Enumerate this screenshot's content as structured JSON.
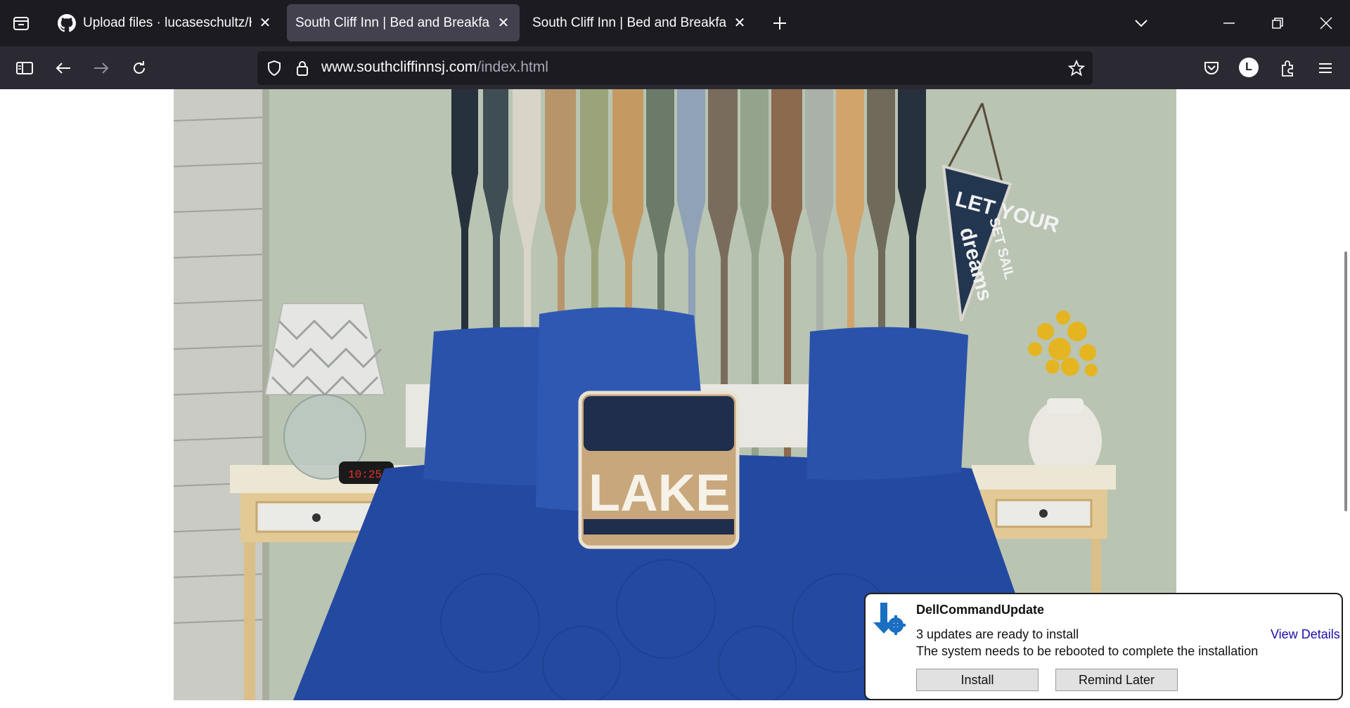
{
  "tabs": [
    {
      "title": "Upload files · lucaseschultz/HTT",
      "active": false,
      "icon": "github-icon"
    },
    {
      "title": "South Cliff Inn | Bed and Breakfast |",
      "active": true
    },
    {
      "title": "South Cliff Inn | Bed and Breakfast |",
      "active": false
    }
  ],
  "address": {
    "host": "www.southcliffinnsj.com",
    "path": "/index.html"
  },
  "account_initial": "L",
  "photo": {
    "pennant_line1": "LET YOUR",
    "pennant_line2": "dreams",
    "pennant_line3": "SET SAIL",
    "pillow_text": "LAKE",
    "clock_text": "10:25"
  },
  "notification": {
    "app_name": "DellCommandUpdate",
    "line1": "3 updates are ready to install",
    "line2": "The system needs to be rebooted to complete the installation",
    "view_details": "View Details",
    "install_label": "Install",
    "remind_label": "Remind Later"
  },
  "colors": {
    "tabbar": "#1c1b22",
    "navbar": "#2b2a33",
    "active_tab": "#42414d",
    "bedspread": "#2349a0"
  }
}
